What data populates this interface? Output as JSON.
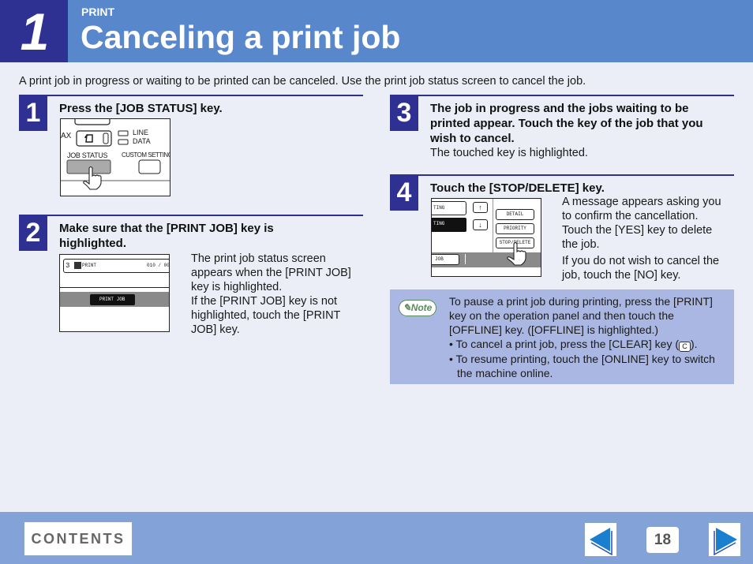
{
  "header": {
    "chapter_number": "1",
    "section_label": "PRINT",
    "title": "Canceling a print job"
  },
  "intro": "A print job in progress or waiting to be printed can be canceled. Use the print job status screen to cancel the job.",
  "steps": [
    {
      "number": "1",
      "title": "Press the [JOB STATUS] key.",
      "panel": {
        "fax_label": "AX",
        "line_label": "LINE",
        "data_label": "DATA",
        "job_status_label": "JOB STATUS",
        "custom_settings_label": "CUSTOM SETTING"
      }
    },
    {
      "number": "2",
      "title": "Make sure that the [PRINT JOB] key is highlighted.",
      "text_lines": [
        "The print job status screen",
        "appears when the [PRINT JOB]",
        "key is highlighted.",
        "If the [PRINT JOB] key is not",
        "highlighted, touch the [PRINT",
        "JOB] key."
      ],
      "panel": {
        "row_number": "3",
        "row_label": "PRINT",
        "row_count": "010 / 00",
        "print_job_label": "PRINT JOB"
      }
    },
    {
      "number": "3",
      "title_lines": [
        "The job in progress and the jobs waiting to be",
        "printed appear. Touch the key of the job that you",
        "wish to cancel."
      ],
      "text": "The touched key is highlighted."
    },
    {
      "number": "4",
      "title": "Touch the [STOP/DELETE] key.",
      "text_lines": [
        "A message appears asking you",
        "to confirm the cancellation.",
        "Touch the [YES] key to delete",
        "the job."
      ],
      "text_lines_2": [
        "If you do not wish to cancel the",
        "job, touch the [NO] key."
      ],
      "panel": {
        "job1_label": "TING",
        "job2_label": "TING",
        "detail_label": "DETAIL",
        "priority_label": "PRIORITY",
        "stop_delete_label": "STOP/DELETE",
        "job_tab_label": "JOB"
      }
    }
  ],
  "note": {
    "badge": "Note",
    "lines": [
      "To pause a print job during printing, press the [PRINT]",
      "key on the operation panel and then touch the",
      "[OFFLINE] key. ([OFFLINE] is highlighted.)"
    ],
    "bullet1_before": "• To cancel a print job, press the [CLEAR] key (",
    "bullet1_key": "C",
    "bullet1_after": ").",
    "bullet2": "• To resume printing, touch the [ONLINE] key to switch the machine online."
  },
  "footer": {
    "contents_label": "CONTENTS",
    "page_number": "18",
    "prev_icon": "prev-page-arrow",
    "next_icon": "next-page-arrow",
    "arrow_color": "#1a7fcf"
  }
}
